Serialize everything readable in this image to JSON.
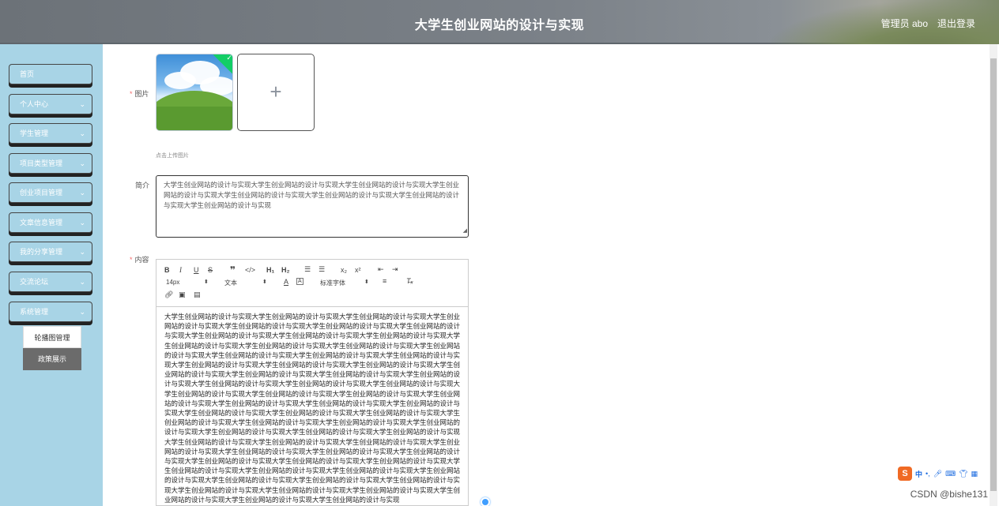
{
  "header": {
    "title": "大学生创业网站的设计与实现",
    "admin": "管理员 abo",
    "logout": "退出登录"
  },
  "sidebar": {
    "items": [
      {
        "label": "首页",
        "chevron": false
      },
      {
        "label": "个人中心",
        "chevron": true
      },
      {
        "label": "学生管理",
        "chevron": true
      },
      {
        "label": "项目类型管理",
        "chevron": true
      },
      {
        "label": "创业项目管理",
        "chevron": true
      },
      {
        "label": "文章信息管理",
        "chevron": true
      },
      {
        "label": "我的分享管理",
        "chevron": true
      },
      {
        "label": "交流论坛",
        "chevron": true
      },
      {
        "label": "系统管理",
        "chevron": true
      }
    ],
    "submenu": [
      "轮播图管理",
      "政策展示"
    ]
  },
  "form": {
    "image_label": "图片",
    "upload_hint": "点击上传图片",
    "summary_label": "简介",
    "summary_text": "大学生创业网站的设计与实现大学生创业网站的设计与实现大学生创业网站的设计与实现大学生创业网站的设计与实现大学生创业网站的设计与实现大学生创业网站的设计与实现大学生创业网站的设计与实现大学生创业网站的设计与实现",
    "content_label": "内容"
  },
  "editor": {
    "font_size": "14px",
    "format": "文本",
    "font_family": "标准字体",
    "content": "大学生创业网站的设计与实现大学生创业网站的设计与实现大学生创业网站的设计与实现大学生创业网站的设计与实现大学生创业网站的设计与实现大学生创业网站的设计与实现大学生创业网站的设计与实现大学生创业网站的设计与实现大学生创业网站的设计与实现大学生创业网站的设计与实现大学生创业网站的设计与实现大学生创业网站的设计与实现大学生创业网站的设计与实现大学生创业网站的设计与实现大学生创业网站的设计与实现大学生创业网站的设计与实现大学生创业网站的设计与实现大学生创业网站的设计与实现大学生创业网站的设计与实现大学生创业网站的设计与实现大学生创业网站的设计与实现大学生创业网站的设计与实现大学生创业网站的设计与实现大学生创业网站的设计与实现大学生创业网站的设计与实现大学生创业网站的设计与实现大学生创业网站的设计与实现大学生创业网站的设计与实现大学生创业网站的设计与实现大学生创业网站的设计与实现大学生创业网站的设计与实现大学生创业网站的设计与实现大学生创业网站的设计与实现大学生创业网站的设计与实现大学生创业网站的设计与实现大学生创业网站的设计与实现大学生创业网站的设计与实现大学生创业网站的设计与实现大学生创业网站的设计与实现大学生创业网站的设计与实现大学生创业网站的设计与实现大学生创业网站的设计与实现大学生创业网站的设计与实现大学生创业网站的设计与实现大学生创业网站的设计与实现大学生创业网站的设计与实现大学生创业网站的设计与实现大学生创业网站的设计与实现大学生创业网站的设计与实现大学生创业网站的设计与实现大学生创业网站的设计与实现大学生创业网站的设计与实现大学生创业网站的设计与实现大学生创业网站的设计与实现大学生创业网站的设计与实现大学生创业网站的设计与实现大学生创业网站的设计与实现大学生创业网站的设计与实现大学生创业网站的设计与实现大学生创业网站的设计与实现大学生创业网站的设计与实现大学生创业网站的设计与实现大学生创业网站的设计与实现大学生创业网站的设计与实现大学生创业网站的设计与实现大学生创业网站的设计与实现大学生创业网站的设计与实现"
  },
  "ime": {
    "logo": "S",
    "lang": "中",
    "punct": "•,"
  },
  "watermark": "CSDN @bishe131"
}
